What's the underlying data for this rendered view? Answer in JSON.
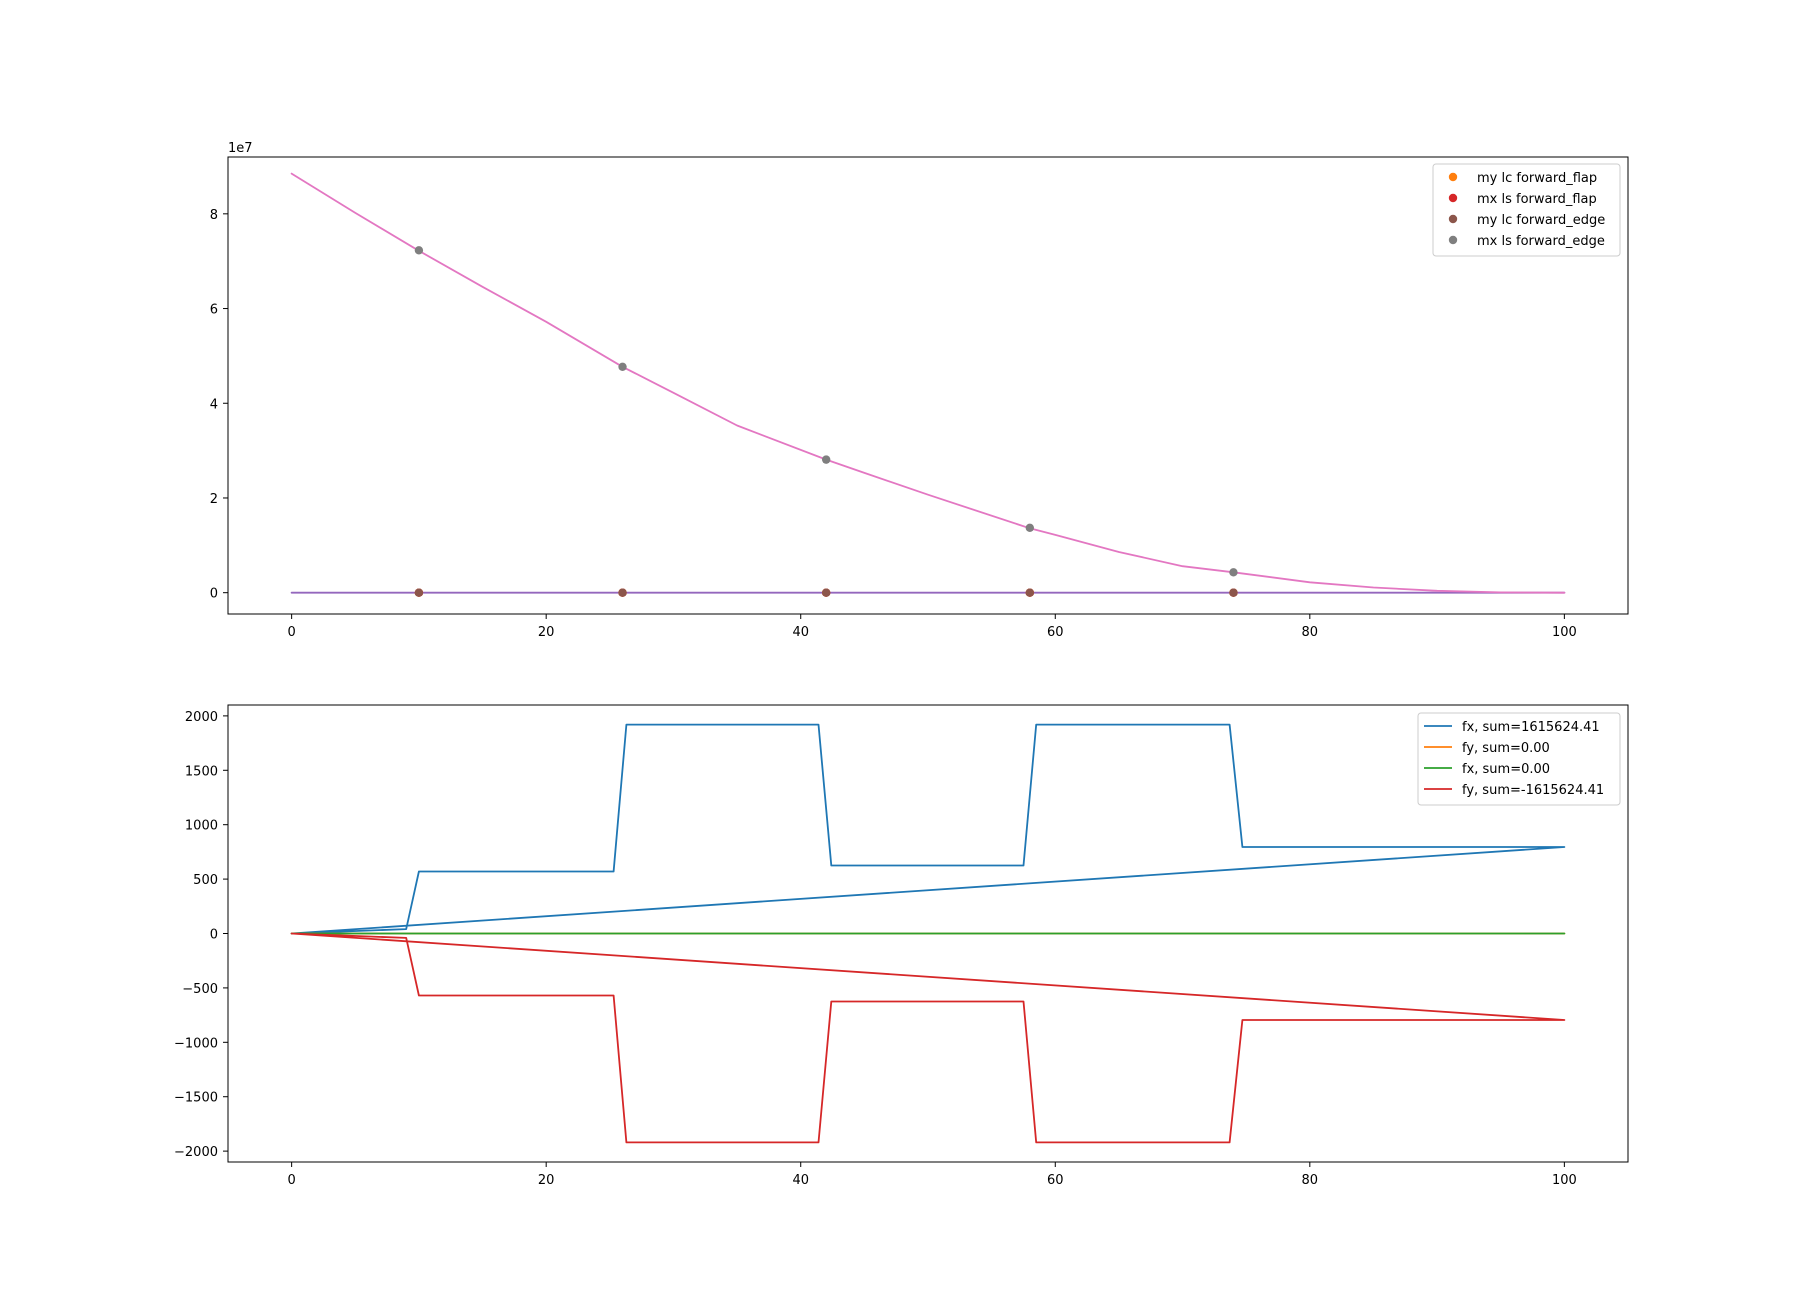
{
  "chart_data": [
    {
      "type": "line",
      "title": "",
      "xlabel": "",
      "ylabel": "",
      "offset_text": "1e7",
      "y_scale": 10000000,
      "xlim": [
        -5,
        105
      ],
      "ylim": [
        -4500000,
        92000000
      ],
      "xticks": [
        0,
        20,
        40,
        60,
        80,
        100
      ],
      "yticks": [
        0,
        20000000,
        40000000,
        60000000,
        80000000
      ],
      "ytick_labels": [
        "0",
        "2",
        "4",
        "6",
        "8"
      ],
      "grid": false,
      "legend_position": "upper right",
      "series": [
        {
          "name": "",
          "style": "line",
          "color": "#9467bd",
          "x": [
            0,
            100
          ],
          "y": [
            0,
            0
          ]
        },
        {
          "name": "",
          "style": "line",
          "color": "#e377c2",
          "x": [
            0,
            5,
            10,
            15,
            20,
            26,
            30,
            35,
            42,
            45,
            50,
            58,
            60,
            65,
            70,
            74,
            80,
            85,
            90,
            95,
            100
          ],
          "y": [
            88500000,
            80200000,
            72200000,
            64600000,
            57200000,
            47700000,
            42200000,
            35300000,
            28100000,
            25300000,
            20700000,
            13600000,
            12200000,
            8600000,
            5600000,
            4300000,
            2200000,
            1100000,
            400000,
            60000,
            0
          ]
        },
        {
          "name": "my lc forward_flap",
          "style": "marker",
          "color": "#ff7f0e",
          "x": [
            10,
            26,
            42,
            58,
            74
          ],
          "y": [
            0,
            0,
            0,
            0,
            0
          ]
        },
        {
          "name": "mx ls forward_flap",
          "style": "marker",
          "color": "#d62728",
          "x": [
            10,
            26,
            42,
            58,
            74
          ],
          "y": [
            0,
            0,
            0,
            0,
            0
          ]
        },
        {
          "name": "my lc forward_edge",
          "style": "marker",
          "color": "#8c564b",
          "x": [
            10,
            26,
            42,
            58,
            74
          ],
          "y": [
            0,
            0,
            0,
            0,
            0
          ]
        },
        {
          "name": "mx ls forward_edge",
          "style": "marker",
          "color": "#7f7f7f",
          "x": [
            10,
            26,
            42,
            58,
            74
          ],
          "y": [
            72300000,
            47700000,
            28100000,
            13700000,
            4300000
          ]
        }
      ]
    },
    {
      "type": "line",
      "title": "",
      "xlabel": "",
      "ylabel": "",
      "xlim": [
        -5,
        105
      ],
      "ylim": [
        -2100,
        2100
      ],
      "xticks": [
        0,
        20,
        40,
        60,
        80,
        100
      ],
      "yticks": [
        -2000,
        -1500,
        -1000,
        -500,
        0,
        500,
        1000,
        1500,
        2000
      ],
      "ytick_labels": [
        "−2000",
        "−1500",
        "−1000",
        "−500",
        "0",
        "500",
        "1000",
        "1500",
        "2000"
      ],
      "grid": false,
      "legend_position": "upper right",
      "series": [
        {
          "name": "fx, sum=1615624.41",
          "style": "line",
          "color": "#1f77b4",
          "x": [
            0,
            9,
            10,
            25.3,
            26.3,
            41.4,
            42.4,
            57.5,
            58.5,
            73.7,
            74.7,
            100,
            0
          ],
          "y": [
            0,
            40,
            570,
            570,
            1920,
            1920,
            625,
            625,
            1920,
            1920,
            795,
            795,
            0
          ]
        },
        {
          "name": "fy, sum=0.00",
          "style": "line",
          "color": "#ff7f0e",
          "x": [
            0,
            100
          ],
          "y": [
            0,
            0
          ]
        },
        {
          "name": "fx, sum=0.00",
          "style": "line",
          "color": "#2ca02c",
          "x": [
            0,
            100
          ],
          "y": [
            0,
            0
          ]
        },
        {
          "name": "fy, sum=-1615624.41",
          "style": "line",
          "color": "#d62728",
          "x": [
            0,
            9,
            10,
            25.3,
            26.3,
            41.4,
            42.4,
            57.5,
            58.5,
            73.7,
            74.7,
            100,
            0
          ],
          "y": [
            0,
            -40,
            -570,
            -570,
            -1920,
            -1920,
            -625,
            -625,
            -1920,
            -1920,
            -795,
            -795,
            0
          ]
        }
      ]
    }
  ]
}
